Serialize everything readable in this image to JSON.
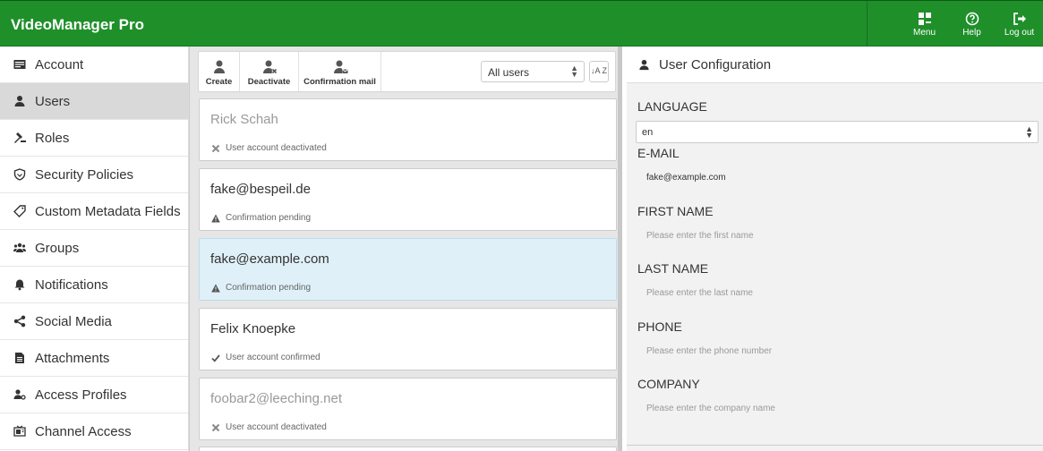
{
  "app": {
    "title": "VideoManager Pro"
  },
  "topnav": [
    {
      "label": "Menu",
      "icon": "grid-menu-icon"
    },
    {
      "label": "Help",
      "icon": "help-circle-icon"
    },
    {
      "label": "Log out",
      "icon": "logout-icon"
    }
  ],
  "sidebar": {
    "items": [
      {
        "label": "Account",
        "icon": "account-card-icon"
      },
      {
        "label": "Users",
        "icon": "user-icon",
        "active": true
      },
      {
        "label": "Roles",
        "icon": "gavel-icon"
      },
      {
        "label": "Security Policies",
        "icon": "shield-icon"
      },
      {
        "label": "Custom Metadata Fields",
        "icon": "tag-icon"
      },
      {
        "label": "Groups",
        "icon": "users-group-icon"
      },
      {
        "label": "Notifications",
        "icon": "bell-icon"
      },
      {
        "label": "Social Media",
        "icon": "share-icon"
      },
      {
        "label": "Attachments",
        "icon": "file-icon"
      },
      {
        "label": "Access Profiles",
        "icon": "user-key-icon"
      },
      {
        "label": "Channel Access",
        "icon": "channel-icon"
      }
    ]
  },
  "toolbar": {
    "create": "Create",
    "deactivate": "Deactivate",
    "confirmation_mail": "Confirmation mail",
    "filter_value": "All users",
    "sort": "↓A Z"
  },
  "users": [
    {
      "title": "Rick Schah",
      "status": "User account deactivated",
      "state": "deactivated"
    },
    {
      "title": "fake@bespeil.de",
      "status": "Confirmation pending",
      "state": "pending"
    },
    {
      "title": "fake@example.com",
      "status": "Confirmation pending",
      "state": "pending",
      "selected": true
    },
    {
      "title": "Felix Knoepke",
      "status": "User account confirmed",
      "state": "confirmed"
    },
    {
      "title": "foobar2@leeching.net",
      "status": "User account deactivated",
      "state": "deactivated"
    }
  ],
  "config": {
    "header": "User Configuration",
    "language_label": "LANGUAGE",
    "language_value": "en",
    "email_label": "E-MAIL",
    "email_value": "fake@example.com",
    "first_name_label": "FIRST NAME",
    "first_name_placeholder": "Please enter the first name",
    "last_name_label": "LAST NAME",
    "last_name_placeholder": "Please enter the last name",
    "phone_label": "PHONE",
    "phone_placeholder": "Please enter the phone number",
    "company_label": "COMPANY",
    "company_placeholder": "Please enter the company name"
  },
  "colors": {
    "brand": "#1f8f2a",
    "selected_row": "#dff0f8",
    "active_nav": "#d9d9d9"
  }
}
